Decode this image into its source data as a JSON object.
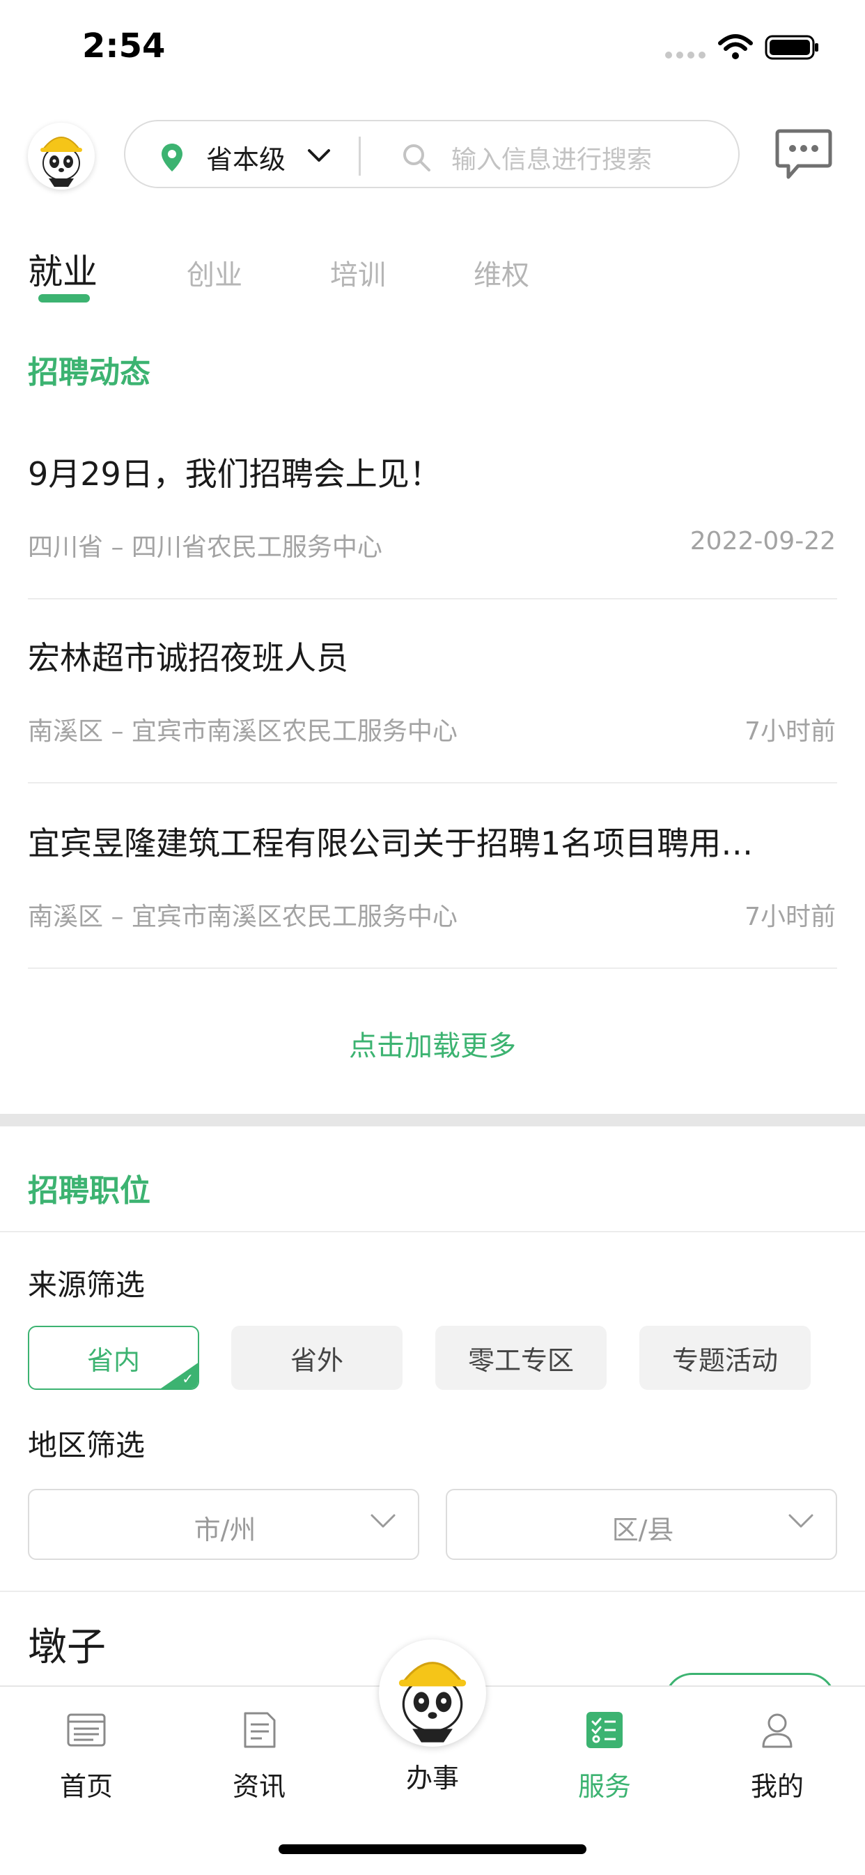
{
  "status_bar": {
    "time": "2:54"
  },
  "header": {
    "location": "省本级",
    "search_placeholder": "输入信息进行搜索"
  },
  "tabs": [
    {
      "label": "就业",
      "active": true
    },
    {
      "label": "创业",
      "active": false
    },
    {
      "label": "培训",
      "active": false
    },
    {
      "label": "维权",
      "active": false
    }
  ],
  "news": {
    "section_title": "招聘动态",
    "items": [
      {
        "title": "9月29日，我们招聘会上见！",
        "source": "四川省 – 四川省农民工服务中心",
        "time": "2022-09-22"
      },
      {
        "title": "宏林超市诚招夜班人员",
        "source": "南溪区 – 宜宾市南溪区农民工服务中心",
        "time": "7小时前"
      },
      {
        "title": "宜宾昱隆建筑工程有限公司关于招聘1名项目聘用…",
        "source": "南溪区 – 宜宾市南溪区农民工服务中心",
        "time": "7小时前"
      }
    ],
    "load_more": "点击加载更多"
  },
  "jobs": {
    "section_title": "招聘职位",
    "source_filter_label": "来源筛选",
    "source_chips": [
      {
        "label": "省内",
        "active": true
      },
      {
        "label": "省外",
        "active": false
      },
      {
        "label": "零工专区",
        "active": false
      },
      {
        "label": "专题活动",
        "active": false
      }
    ],
    "region_filter_label": "地区筛选",
    "city_select": "市/州",
    "district_select": "区/县",
    "first_job_title": "墩子"
  },
  "bottom_nav": {
    "items": [
      {
        "label": "首页",
        "icon": "home-list-icon",
        "active": false
      },
      {
        "label": "资讯",
        "icon": "news-icon",
        "active": false
      },
      {
        "label": "办事",
        "icon": "panda-mascot-icon",
        "active": false
      },
      {
        "label": "服务",
        "icon": "service-checklist-icon",
        "active": true
      },
      {
        "label": "我的",
        "icon": "person-icon",
        "active": false
      }
    ]
  },
  "colors": {
    "accent": "#3cb371",
    "muted": "#a3a3a3"
  }
}
